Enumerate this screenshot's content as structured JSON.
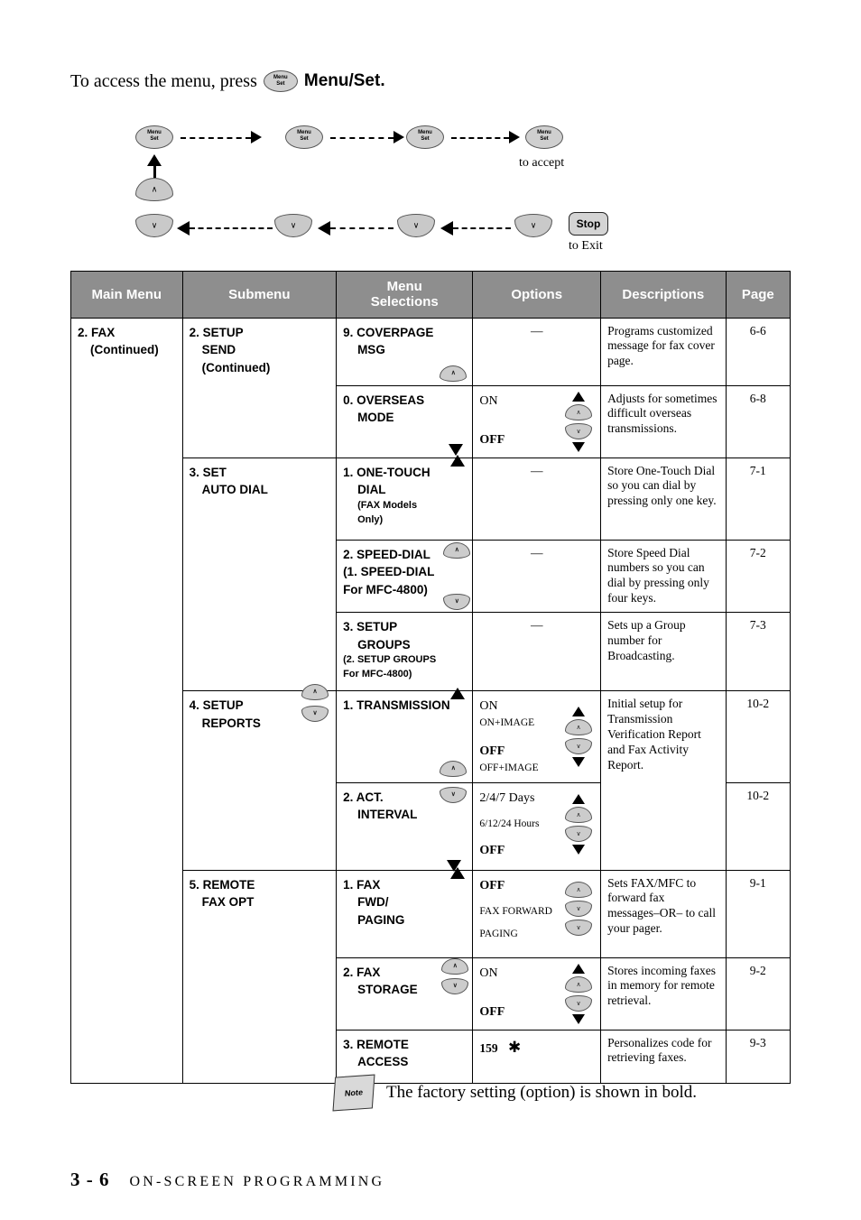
{
  "intro": {
    "before": "To access the menu, press",
    "button_line1": "Menu",
    "button_line2": "Set",
    "after": "Menu/Set."
  },
  "diagram": {
    "button_line1": "Menu",
    "button_line2": "Set",
    "stop_label": "Stop",
    "to_accept": "to accept",
    "to_exit": "to Exit",
    "up_glyph": "∧",
    "down_glyph": "∨",
    "left_glyph": "←",
    "right_glyph": "→"
  },
  "table": {
    "headers": {
      "main": "Main Menu",
      "sub": "Submenu",
      "sel_line1": "Menu",
      "sel_line2": "Selections",
      "options": "Options",
      "descriptions": "Descriptions",
      "page": "Page"
    },
    "main_menu": {
      "line1": "2. FAX",
      "line2": "(Continued)"
    },
    "groups": [
      {
        "submenu": [
          "2. SETUP",
          "SEND",
          "(Continued)"
        ],
        "rows": [
          {
            "sel": [
              "9.  COVERPAGE",
              "MSG"
            ],
            "options": [],
            "option_dash": "—",
            "arrows": false,
            "desc": "Programs customized message for fax cover page.",
            "page": "6-6"
          },
          {
            "sel": [
              "0.  OVERSEAS",
              "MODE"
            ],
            "options": [
              {
                "text": "ON",
                "bold": false,
                "small": false
              },
              {
                "text": "OFF",
                "bold": true,
                "small": false
              }
            ],
            "option_dash": "",
            "arrows": true,
            "desc": "Adjusts for sometimes difficult overseas transmissions.",
            "page": "6-8"
          }
        ]
      },
      {
        "submenu": [
          "3. SET",
          "AUTO DIAL"
        ],
        "rows": [
          {
            "sel": [
              "1.  ONE-TOUCH",
              "DIAL",
              "(FAX Models",
              "Only)"
            ],
            "options": [],
            "option_dash": "—",
            "arrows": false,
            "desc": "Store One-Touch Dial so you can dial by pressing only one key.",
            "page": "7-1"
          },
          {
            "sel": [
              "2.  SPEED-DIAL",
              "(1. SPEED-DIAL",
              "For MFC-4800)"
            ],
            "options": [],
            "option_dash": "—",
            "arrows": false,
            "desc": "Store Speed Dial numbers so you can dial by pressing only four keys.",
            "page": "7-2"
          },
          {
            "sel": [
              "3.  SETUP",
              "GROUPS",
              "(2. SETUP GROUPS",
              "For MFC-4800)"
            ],
            "options": [],
            "option_dash": "—",
            "arrows": false,
            "desc": "Sets up a Group number for Broadcasting.",
            "page": "7-3"
          }
        ]
      },
      {
        "submenu": [
          "4. SETUP",
          "REPORTS"
        ],
        "rows": [
          {
            "sel": [
              "1.   TRANSMISSION"
            ],
            "options": [
              {
                "text": "ON",
                "bold": false,
                "small": false
              },
              {
                "text": "ON+IMAGE",
                "bold": false,
                "small": true
              },
              {
                "text": "OFF",
                "bold": true,
                "small": false
              },
              {
                "text": "OFF+IMAGE",
                "bold": false,
                "small": true
              }
            ],
            "option_dash": "",
            "arrows": true,
            "desc": "Initial setup for Transmission Verification Report and Fax Activity Report.",
            "page": "10-2"
          },
          {
            "sel": [
              "2.  ACT.",
              "INTERVAL"
            ],
            "options": [
              {
                "text": "2/4/7 Days",
                "bold": false,
                "small": false
              },
              {
                "text": "6/12/24 Hours",
                "bold": false,
                "small": true
              },
              {
                "text": "OFF",
                "bold": true,
                "small": false
              }
            ],
            "option_dash": "",
            "arrows": true,
            "desc": "",
            "page": "10-2"
          }
        ]
      },
      {
        "submenu": [
          "5. REMOTE",
          "FAX OPT"
        ],
        "rows": [
          {
            "sel": [
              "1.  FAX",
              "FWD/",
              "PAGING"
            ],
            "options": [
              {
                "text": "OFF",
                "bold": true,
                "small": false
              },
              {
                "text": "FAX FORWARD",
                "bold": false,
                "small": true
              },
              {
                "text": "PAGING",
                "bold": false,
                "small": true
              }
            ],
            "option_dash": "",
            "arrows": true,
            "desc": "Sets FAX/MFC to forward fax messages–OR– to call your pager.",
            "page": "9-1"
          },
          {
            "sel": [
              "2.  FAX",
              "STORAGE"
            ],
            "options": [
              {
                "text": "ON",
                "bold": false,
                "small": false
              },
              {
                "text": "OFF",
                "bold": true,
                "small": false
              }
            ],
            "option_dash": "",
            "arrows": true,
            "desc": "Stores incoming faxes in memory for remote retrieval.",
            "page": "9-2"
          },
          {
            "sel": [
              "3.  REMOTE",
              "ACCESS"
            ],
            "options": [
              {
                "text": "159",
                "bold": true,
                "small": false
              }
            ],
            "option_dash": "",
            "arrows": false,
            "has_star": true,
            "desc": "Personalizes code for retrieving faxes.",
            "page": "9-3"
          }
        ]
      }
    ]
  },
  "note": {
    "icon_label": "Note",
    "text": "The factory setting (option) is shown in bold."
  },
  "footer": {
    "page_number": "3 - 6",
    "chapter": "ON-SCREEN PROGRAMMING"
  }
}
